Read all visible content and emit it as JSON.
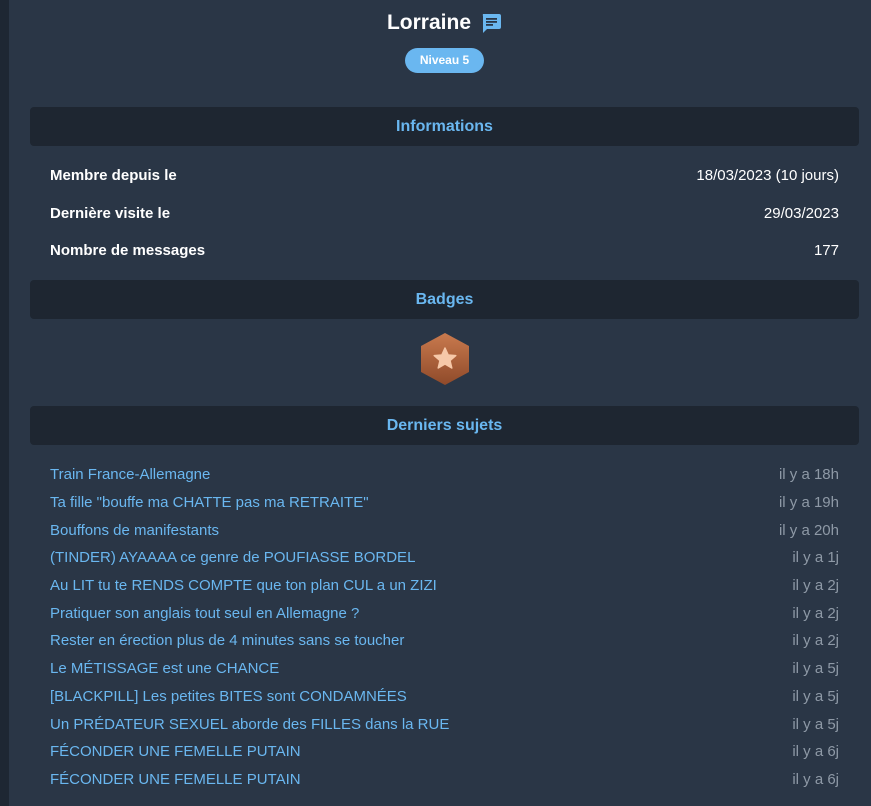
{
  "profile": {
    "username": "Lorraine",
    "message_icon": "chat-message-icon",
    "level": "Niveau 5"
  },
  "sections": {
    "informations": "Informations",
    "badges": "Badges",
    "topics": "Derniers sujets"
  },
  "info": [
    {
      "label": "Membre depuis le",
      "value": "18/03/2023 (10 jours)"
    },
    {
      "label": "Dernière visite le",
      "value": "29/03/2023"
    },
    {
      "label": "Nombre de messages",
      "value": "177"
    }
  ],
  "badge": {
    "icon": "bronze-star-badge-icon"
  },
  "topics": [
    {
      "title": "Train France-Allemagne",
      "time": "il y a 18h"
    },
    {
      "title": "Ta fille \"bouffe ma CHATTE pas ma RETRAITE\"",
      "time": "il y a 19h"
    },
    {
      "title": "Bouffons de manifestants",
      "time": "il y a 20h"
    },
    {
      "title": "(TINDER) AYAAAA ce genre de POUFIASSE BORDEL",
      "time": "il y a 1j"
    },
    {
      "title": "Au LIT tu te RENDS COMPTE que ton plan CUL a un ZIZI",
      "time": "il y a 2j"
    },
    {
      "title": "Pratiquer son anglais tout seul en Allemagne ?",
      "time": "il y a 2j"
    },
    {
      "title": "Rester en érection plus de 4 minutes sans se toucher",
      "time": "il y a 2j"
    },
    {
      "title": "Le MÉTISSAGE est une CHANCE",
      "time": "il y a 5j"
    },
    {
      "title": "[BLACKPILL] Les petites BITES sont CONDAMNÉES",
      "time": "il y a 5j"
    },
    {
      "title": "Un PRÉDATEUR SEXUEL aborde des FILLES dans la RUE",
      "time": "il y a 5j"
    },
    {
      "title": "FÉCONDER UNE FEMELLE PUTAIN",
      "time": "il y a 6j"
    },
    {
      "title": "FÉCONDER UNE FEMELLE PUTAIN",
      "time": "il y a 6j"
    }
  ],
  "colors": {
    "background": "#2a3646",
    "section_header_bg": "#1e2631",
    "accent": "#6ab7f0",
    "muted": "#8e99a6",
    "badge_bronze": "#b0603a"
  }
}
